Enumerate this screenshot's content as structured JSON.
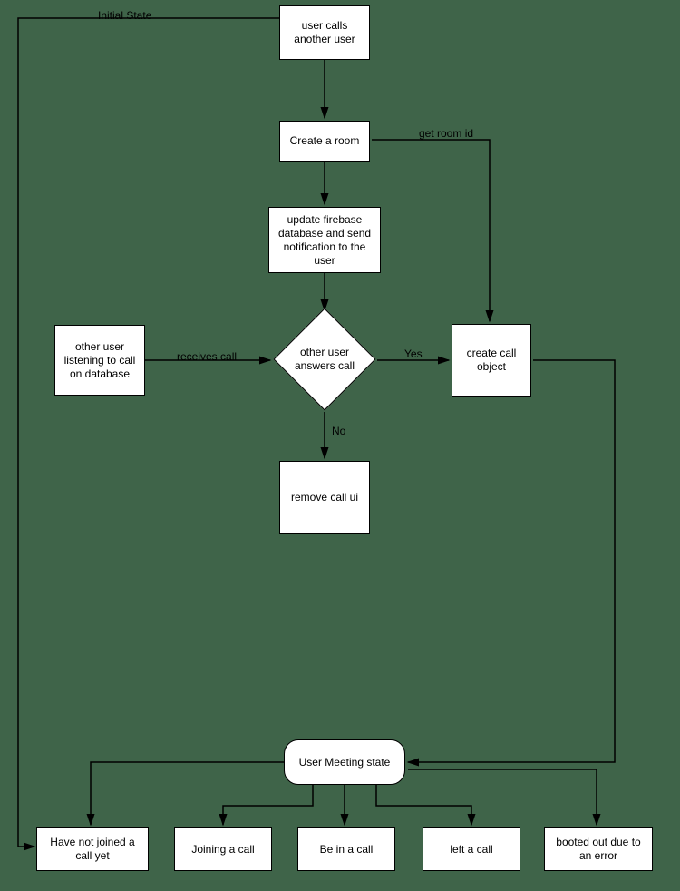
{
  "nodes": {
    "n1": "user calls another user",
    "n2": "Create a room",
    "n3": "update firebase database and send notification to the user",
    "n4": "other user listening to call on database",
    "n5": "other user answers call",
    "n6": "create call object",
    "n7": "remove call ui",
    "n8": "User Meeting state",
    "s1": "Have not joined a call yet",
    "s2": "Joining a call",
    "s3": "Be in a call",
    "s4": "left a call",
    "s5": "booted out due to an error"
  },
  "edge_labels": {
    "initial_state": "Initial State",
    "get_room_id": "get room id",
    "receives_call": "receives call",
    "yes": "Yes",
    "no": "No"
  }
}
